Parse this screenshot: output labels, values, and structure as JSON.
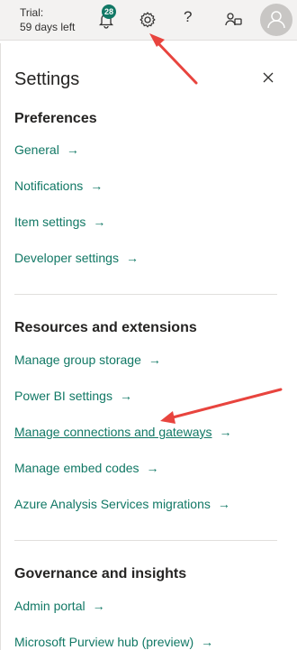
{
  "topbar": {
    "trial_line1": "Trial:",
    "trial_line2": "59 days left",
    "notification_count": "28",
    "help_symbol": "?"
  },
  "settings": {
    "title": "Settings",
    "close_symbol": "×",
    "sections": [
      {
        "title": "Preferences",
        "links": [
          "General",
          "Notifications",
          "Item settings",
          "Developer settings"
        ]
      },
      {
        "title": "Resources and extensions",
        "links": [
          "Manage group storage",
          "Power BI settings",
          "Manage connections and gateways",
          "Manage embed codes",
          "Azure Analysis Services migrations"
        ]
      },
      {
        "title": "Governance and insights",
        "links": [
          "Admin portal",
          "Microsoft Purview hub (preview)"
        ]
      }
    ],
    "link_arrow": "→"
  },
  "colors": {
    "accent": "#117865",
    "annotation": "#e8443e"
  }
}
